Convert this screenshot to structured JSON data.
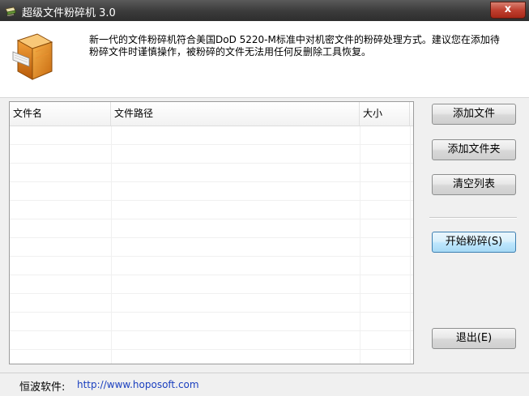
{
  "window": {
    "title": "超级文件粉碎机  3.0",
    "close_label": "x"
  },
  "header": {
    "description": "新一代的文件粉碎机符合美国DoD 5220-M标准中对机密文件的粉碎处理方式。建议您在添加待粉碎文件时谨慎操作，被粉碎的文件无法用任何反删除工具恢复。"
  },
  "file_list": {
    "columns": [
      "文件名",
      "文件路径",
      "大小"
    ],
    "rows": []
  },
  "buttons": {
    "add_file": "添加文件",
    "add_folder": "添加文件夹",
    "clear_list": "清空列表",
    "start_shred": "开始粉碎(S)",
    "exit": "退出(E)"
  },
  "status_bar": {
    "company": "恒波软件:",
    "url": "http://www.hoposoft.com"
  },
  "icons": {
    "app": "shredder-icon",
    "logo": "file-shredder-logo"
  }
}
